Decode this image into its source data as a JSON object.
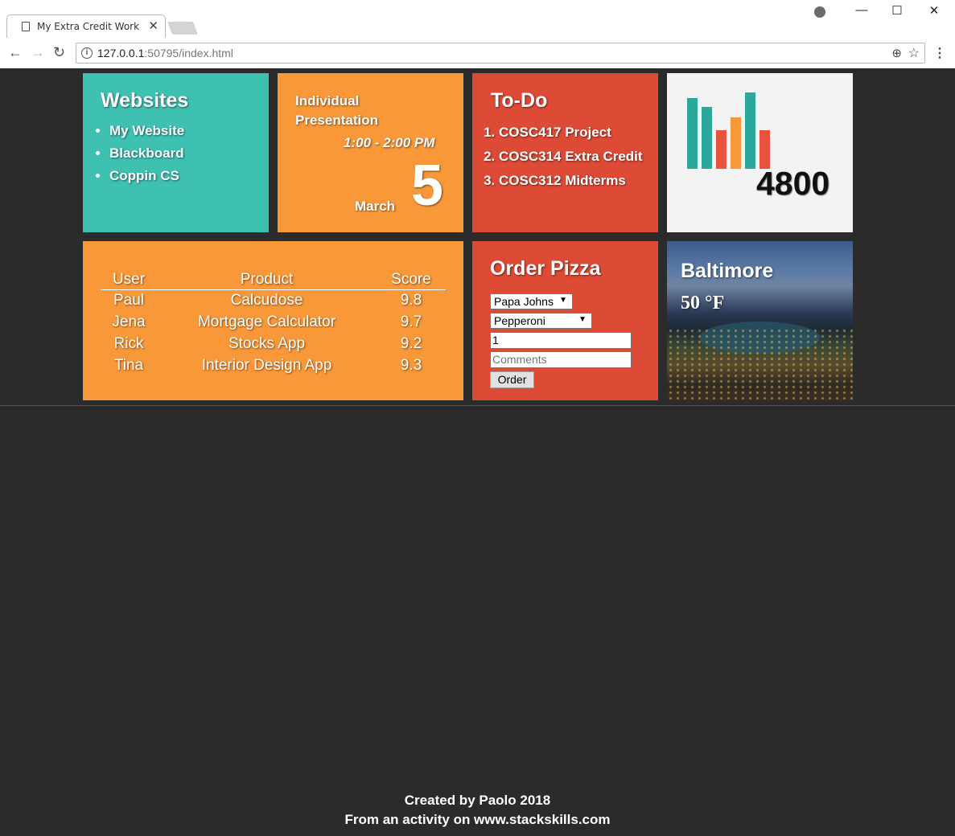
{
  "browser": {
    "tab_title": "My Extra Credit Work",
    "url_host": "127.0.0.1",
    "url_rest": ":50795/index.html"
  },
  "websites": {
    "title": "Websites",
    "links": [
      "My Website",
      "Blackboard",
      "Coppin CS"
    ]
  },
  "presentation": {
    "title": "Individual Presentation",
    "time": "1:00 - 2:00 PM",
    "month": "March",
    "day": "5"
  },
  "todo": {
    "title": "To-Do",
    "items": [
      "COSC417 Project",
      "COSC314 Extra Credit",
      "COSC312 Midterms"
    ]
  },
  "stats": {
    "value": "4800",
    "bars": [
      {
        "level": 0.79,
        "color": "#2aa89a"
      },
      {
        "level": 0.69,
        "color": "#2aa89a"
      },
      {
        "level": 0.43,
        "color": "#e9523e"
      },
      {
        "level": 0.57,
        "color": "#f99838"
      },
      {
        "level": 0.85,
        "color": "#2aa89a"
      },
      {
        "level": 0.43,
        "color": "#e9523e"
      }
    ]
  },
  "scores": {
    "headers": [
      "User",
      "Product",
      "Score"
    ],
    "rows": [
      [
        "Paul",
        "Calcudose",
        "9.8"
      ],
      [
        "Jena",
        "Mortgage Calculator",
        "9.7"
      ],
      [
        "Rick",
        "Stocks App",
        "9.2"
      ],
      [
        "Tina",
        "Interior Design App",
        "9.3"
      ]
    ]
  },
  "pizza": {
    "title": "Order Pizza",
    "store": "Papa Johns",
    "topping": "Pepperoni",
    "quantity": "1",
    "comments_placeholder": "Comments",
    "order_label": "Order"
  },
  "weather": {
    "city": "Baltimore",
    "temp": "50 °F"
  },
  "footer": {
    "line1": "Created by Paolo 2018",
    "line2": "From an activity on www.stackskills.com"
  },
  "colors": {
    "teal": "#3fc1b2",
    "orange": "#f99838",
    "red": "#dd4b36",
    "page_bg": "#2b2b2b"
  }
}
